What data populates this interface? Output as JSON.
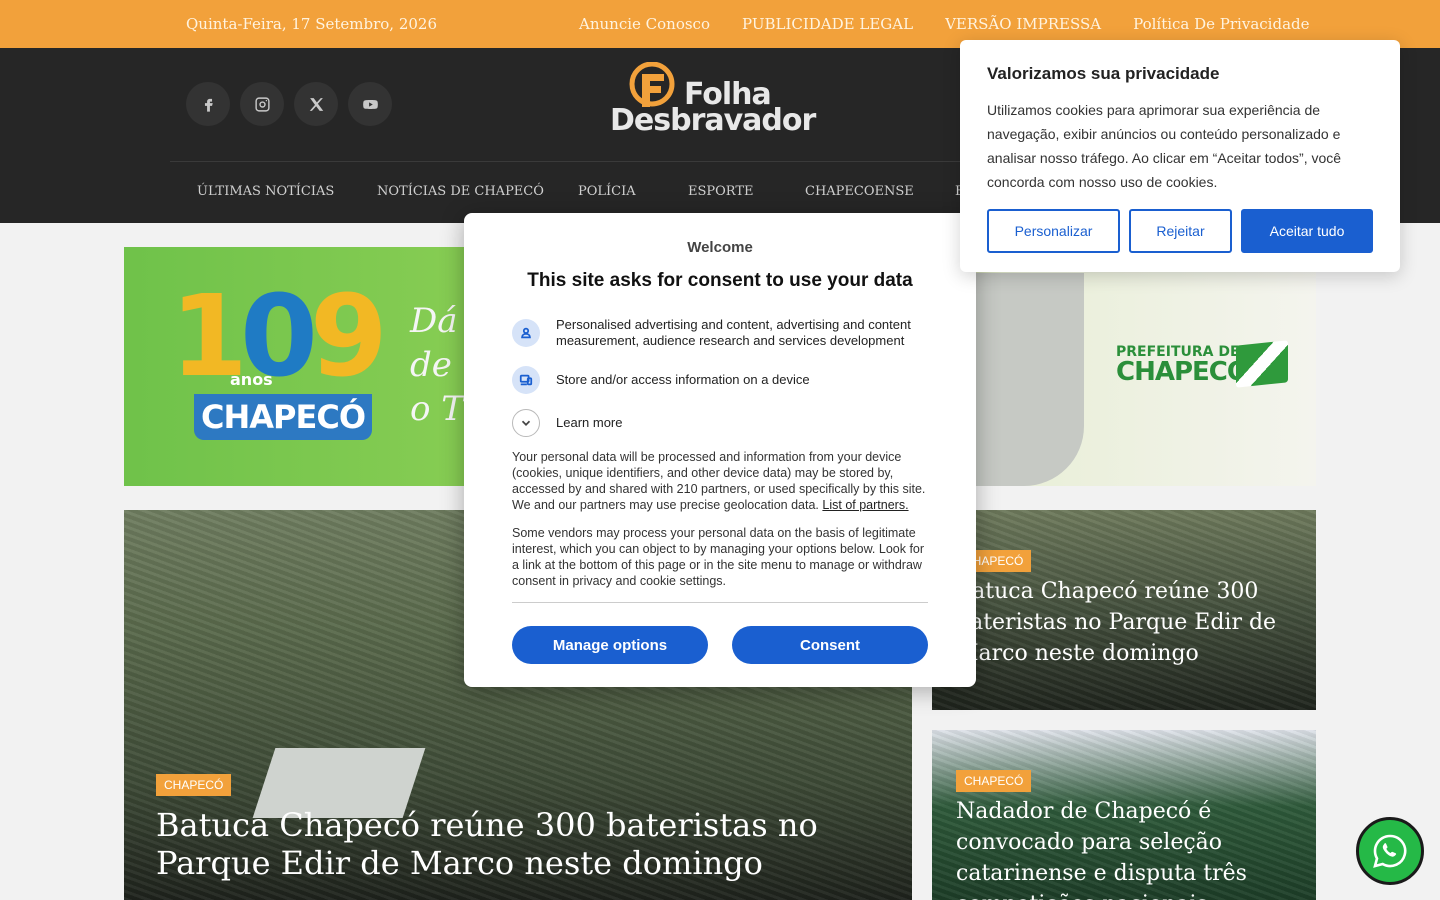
{
  "topbar": {
    "date": "Quinta-Feira, 17 Setembro, 2026",
    "links": [
      "Anuncie Conosco",
      "PUBLICIDADE LEGAL",
      "VERSÃO IMPRESSA",
      "Política De Privacidade"
    ]
  },
  "header": {
    "logo_line1": "Folha",
    "logo_line2": "Desbravador",
    "social": [
      "facebook-icon",
      "instagram-icon",
      "x-icon",
      "youtube-icon"
    ],
    "nav": [
      "ÚLTIMAS NOTÍCIAS",
      "NOTÍCIAS DE CHAPECÓ",
      "POLÍCIA",
      "ESPORTE",
      "CHAPECOENSE",
      "E"
    ]
  },
  "banner": {
    "number": "109",
    "anos": "anos",
    "city": "CHAPECÓ",
    "slogan_line1": "Dá",
    "slogan_line2": "de t",
    "slogan_line3": "o T",
    "pref_line1": "PREFEITURA DE",
    "pref_line2": "CHAPECÓ"
  },
  "articles": [
    {
      "tag": "CHAPECÓ",
      "title": "Batuca Chapecó reúne 300 bateristas no Parque Edir de Marco neste domingo"
    },
    {
      "tag": "CHAPECÓ",
      "title": "Batuca Chapecó reúne 300 bateristas no Parque Edir de Marco neste domingo"
    },
    {
      "tag": "CHAPECÓ",
      "title": "Nadador de Chapecó é convocado para seleção catarinense e disputa três competições nacionais"
    }
  ],
  "consent": {
    "welcome": "Welcome",
    "title": "This site asks for consent to use your data",
    "purpose1": "Personalised advertising and content, advertising and content measurement, audience research and services development",
    "purpose2": "Store and/or access information on a device",
    "learn_more": "Learn more",
    "para1": "Your personal data will be processed and information from your device (cookies, unique identifiers, and other device data) may be stored by, accessed by and shared with 210 partners, or used specifically by this site. We and our partners may use precise geolocation data.",
    "partners_link": "List of partners.",
    "para2": "Some vendors may process your personal data on the basis of legitimate interest, which you can object to by managing your options below. Look for a link at the bottom of this page or in the site menu to manage or withdraw consent in privacy and cookie settings.",
    "manage_button": "Manage options",
    "consent_button": "Consent"
  },
  "cookie": {
    "title": "Valorizamos sua privacidade",
    "text": "Utilizamos cookies para aprimorar sua experiência de navegação, exibir anúncios ou conteúdo personalizado e analisar nosso tráfego. Ao clicar em “Aceitar todos”, você concorda com nosso uso de cookies.",
    "customize": "Personalizar",
    "reject": "Rejeitar",
    "accept": "Aceitar tudo"
  },
  "colors": {
    "accent": "#f2a13b",
    "header": "#262626",
    "primary_button": "#1a5fd0",
    "whatsapp": "#25b947"
  }
}
